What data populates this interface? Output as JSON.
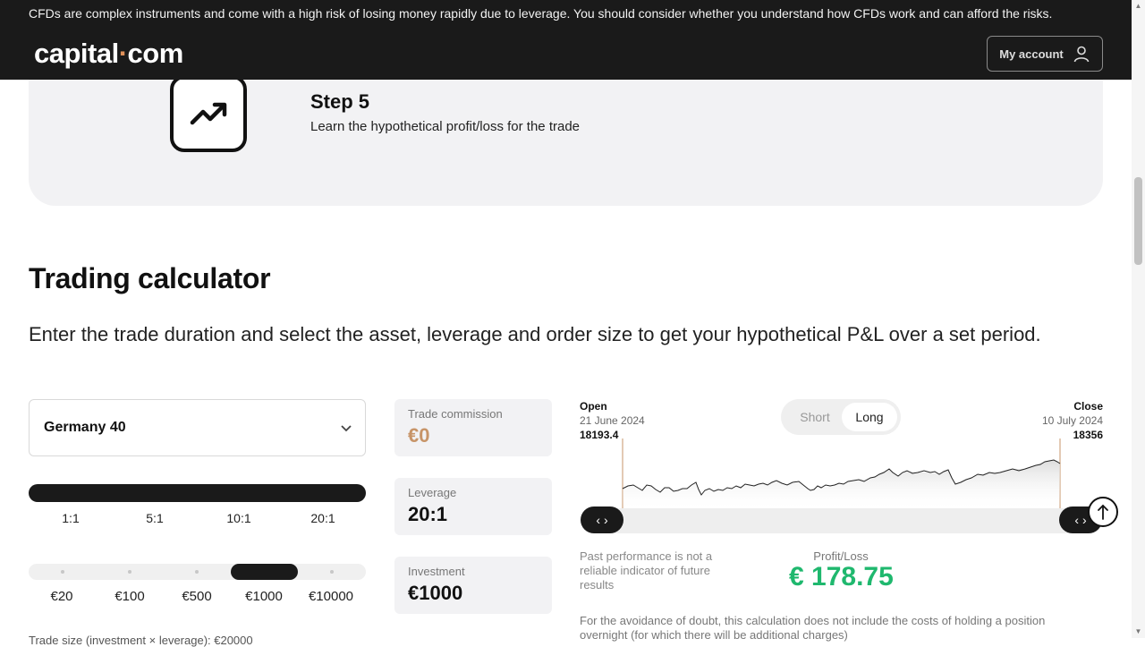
{
  "header": {
    "disclaimer": "CFDs are complex instruments and come with a high risk of losing money rapidly due to leverage. You should consider whether you understand how CFDs work and can afford the risks.",
    "logo_left": "capital",
    "logo_dot": "·",
    "logo_right": "com",
    "account_label": "My account",
    "account_icon": "user-icon"
  },
  "step": {
    "icon": "trend-up-icon",
    "title": "Step 5",
    "description": "Learn the hypothetical profit/loss for the trade"
  },
  "calculator": {
    "title": "Trading calculator",
    "description": "Enter the trade duration and select the asset, leverage and order size to get your hypothetical P&L over a set period.",
    "asset_selected": "Germany 40",
    "leverage_options": [
      "1:1",
      "5:1",
      "10:1",
      "20:1"
    ],
    "leverage_selected": "20:1",
    "investment_options": [
      "€20",
      "€100",
      "€500",
      "€1000",
      "€10000"
    ],
    "investment_selected": "€1000",
    "footnote_cut": "Trade size (investment × leverage): €20000",
    "cards": {
      "commission_label": "Trade commission",
      "commission_value": "€0",
      "leverage_label": "Leverage",
      "leverage_value": "20:1",
      "investment_label": "Investment",
      "investment_value": "€1000"
    }
  },
  "chart": {
    "open_label": "Open",
    "open_date": "21 June 2024",
    "open_price": "18193.4",
    "close_label": "Close",
    "close_date": "10 July 2024",
    "close_price": "18356",
    "toggle_short": "Short",
    "toggle_long": "Long",
    "toggle_selected": "Long",
    "handle_left_icons": "‹ ›",
    "handle_right_icons": "‹ ›",
    "accent_color": "#c79468",
    "profit_color": "#1fb86e"
  },
  "results": {
    "past_performance": "Past performance is not a reliable indicator of future results",
    "pl_label": "Profit/Loss",
    "pl_value": "€ 178.75",
    "avoidance": "For the avoidance of doubt, this calculation does not include the costs of holding a position overnight (for which there will be additional charges)"
  }
}
